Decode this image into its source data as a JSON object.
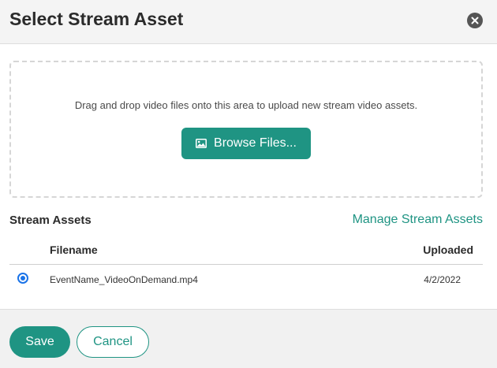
{
  "dialog": {
    "title": "Select Stream Asset"
  },
  "icons": {
    "close": "close-icon",
    "browse": "image-icon"
  },
  "dropzone": {
    "text": "Drag and drop video files onto this area to upload new stream video assets.",
    "browse_label": "Browse Files..."
  },
  "assets": {
    "section_title": "Stream Assets",
    "manage_link": "Manage Stream Assets",
    "columns": {
      "filename": "Filename",
      "uploaded": "Uploaded"
    },
    "rows": [
      {
        "filename": "EventName_VideoOnDemand.mp4",
        "uploaded": "4/2/2022",
        "selected": true
      }
    ]
  },
  "footer": {
    "save_label": "Save",
    "cancel_label": "Cancel"
  },
  "colors": {
    "accent": "#1f9483",
    "radio": "#1a73e8",
    "header_bg": "#f4f4f4"
  }
}
